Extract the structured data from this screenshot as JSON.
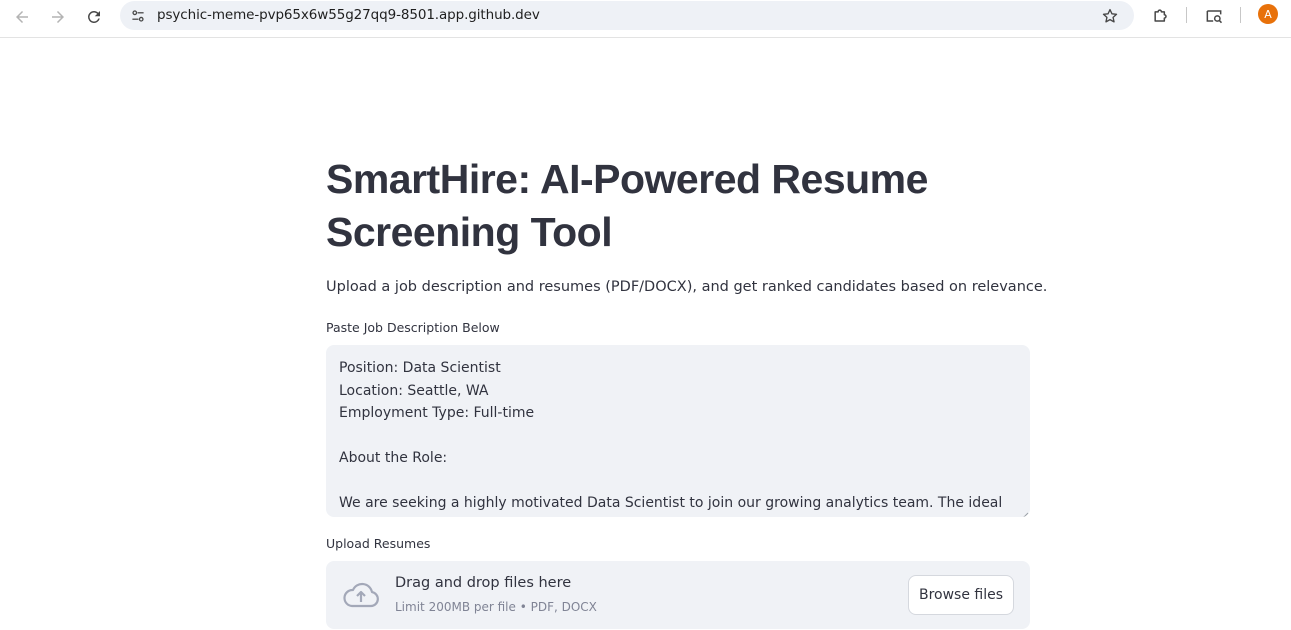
{
  "browser": {
    "url": "psychic-meme-pvp65x6w55g27qq9-8501.app.github.dev",
    "profile_initial": "A",
    "accent_color": "#e8710a"
  },
  "page": {
    "title": "SmartHire: AI-Powered Resume Screening Tool",
    "subtitle": "Upload a job description and resumes (PDF/DOCX), and get ranked candidates based on relevance.",
    "job_description": {
      "label": "Paste Job Description Below",
      "lines": [
        "Position: Data Scientist",
        "Location: Seattle, WA",
        "Employment Type: Full-time",
        "",
        "About the Role:",
        "",
        "We are seeking a highly motivated Data Scientist to join our growing analytics team. The ideal"
      ]
    },
    "uploader": {
      "label": "Upload Resumes",
      "drop_text": "Drag and drop files here",
      "limit_text": "Limit 200MB per file • PDF, DOCX",
      "browse_label": "Browse files"
    }
  }
}
